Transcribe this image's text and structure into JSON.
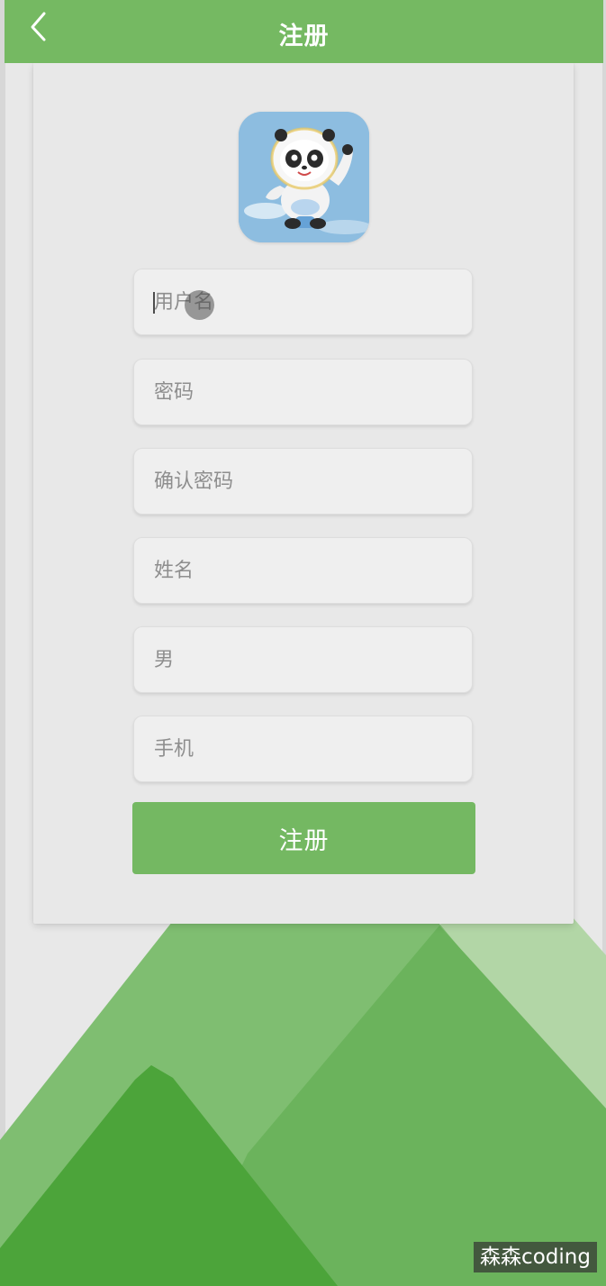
{
  "header": {
    "title": "注册",
    "back_icon": "chevron-left-icon"
  },
  "form": {
    "username_placeholder": "用户名",
    "password_placeholder": "密码",
    "confirm_password_placeholder": "确认密码",
    "name_placeholder": "姓名",
    "gender_placeholder": "男",
    "phone_placeholder": "手机"
  },
  "submit": {
    "label": "注册"
  },
  "watermark": {
    "text": "森森coding"
  },
  "colors": {
    "primary": "#75b962",
    "mountain_dark": "#4ca43a",
    "mountain_mid": "#6bb35c",
    "mountain_light": "#b2d6a6",
    "background": "#e8e8e8"
  }
}
